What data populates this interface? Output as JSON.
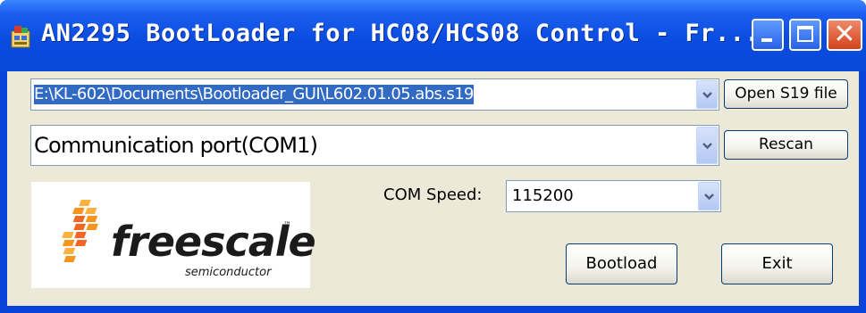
{
  "window": {
    "title": "AN2295 BootLoader for HC08/HCS08 Control - Fr...",
    "buttons": {
      "minimize": "minimize",
      "maximize": "maximize",
      "close": "close"
    }
  },
  "file": {
    "path": "E:\\KL-602\\Documents\\Bootloader_GUI\\L602.01.05.abs.s19",
    "open_label": "Open S19 file"
  },
  "port": {
    "selected": "Communication port(COM1)",
    "rescan_label": "Rescan"
  },
  "speed": {
    "label": "COM Speed:",
    "selected": "115200"
  },
  "logo": {
    "brand": "freescale",
    "tm": "™",
    "subtitle": "semiconductor"
  },
  "actions": {
    "bootload_label": "Bootload",
    "exit_label": "Exit"
  },
  "colors": {
    "titlebar": "#0a4ce0",
    "client": "#ece9d8",
    "selection": "#316ac5",
    "logo_orange": "#f7941d"
  },
  "icons": [
    "app-icon",
    "minimize-icon",
    "maximize-icon",
    "close-icon",
    "chevron-down-icon",
    "freescale-logo-icon"
  ]
}
